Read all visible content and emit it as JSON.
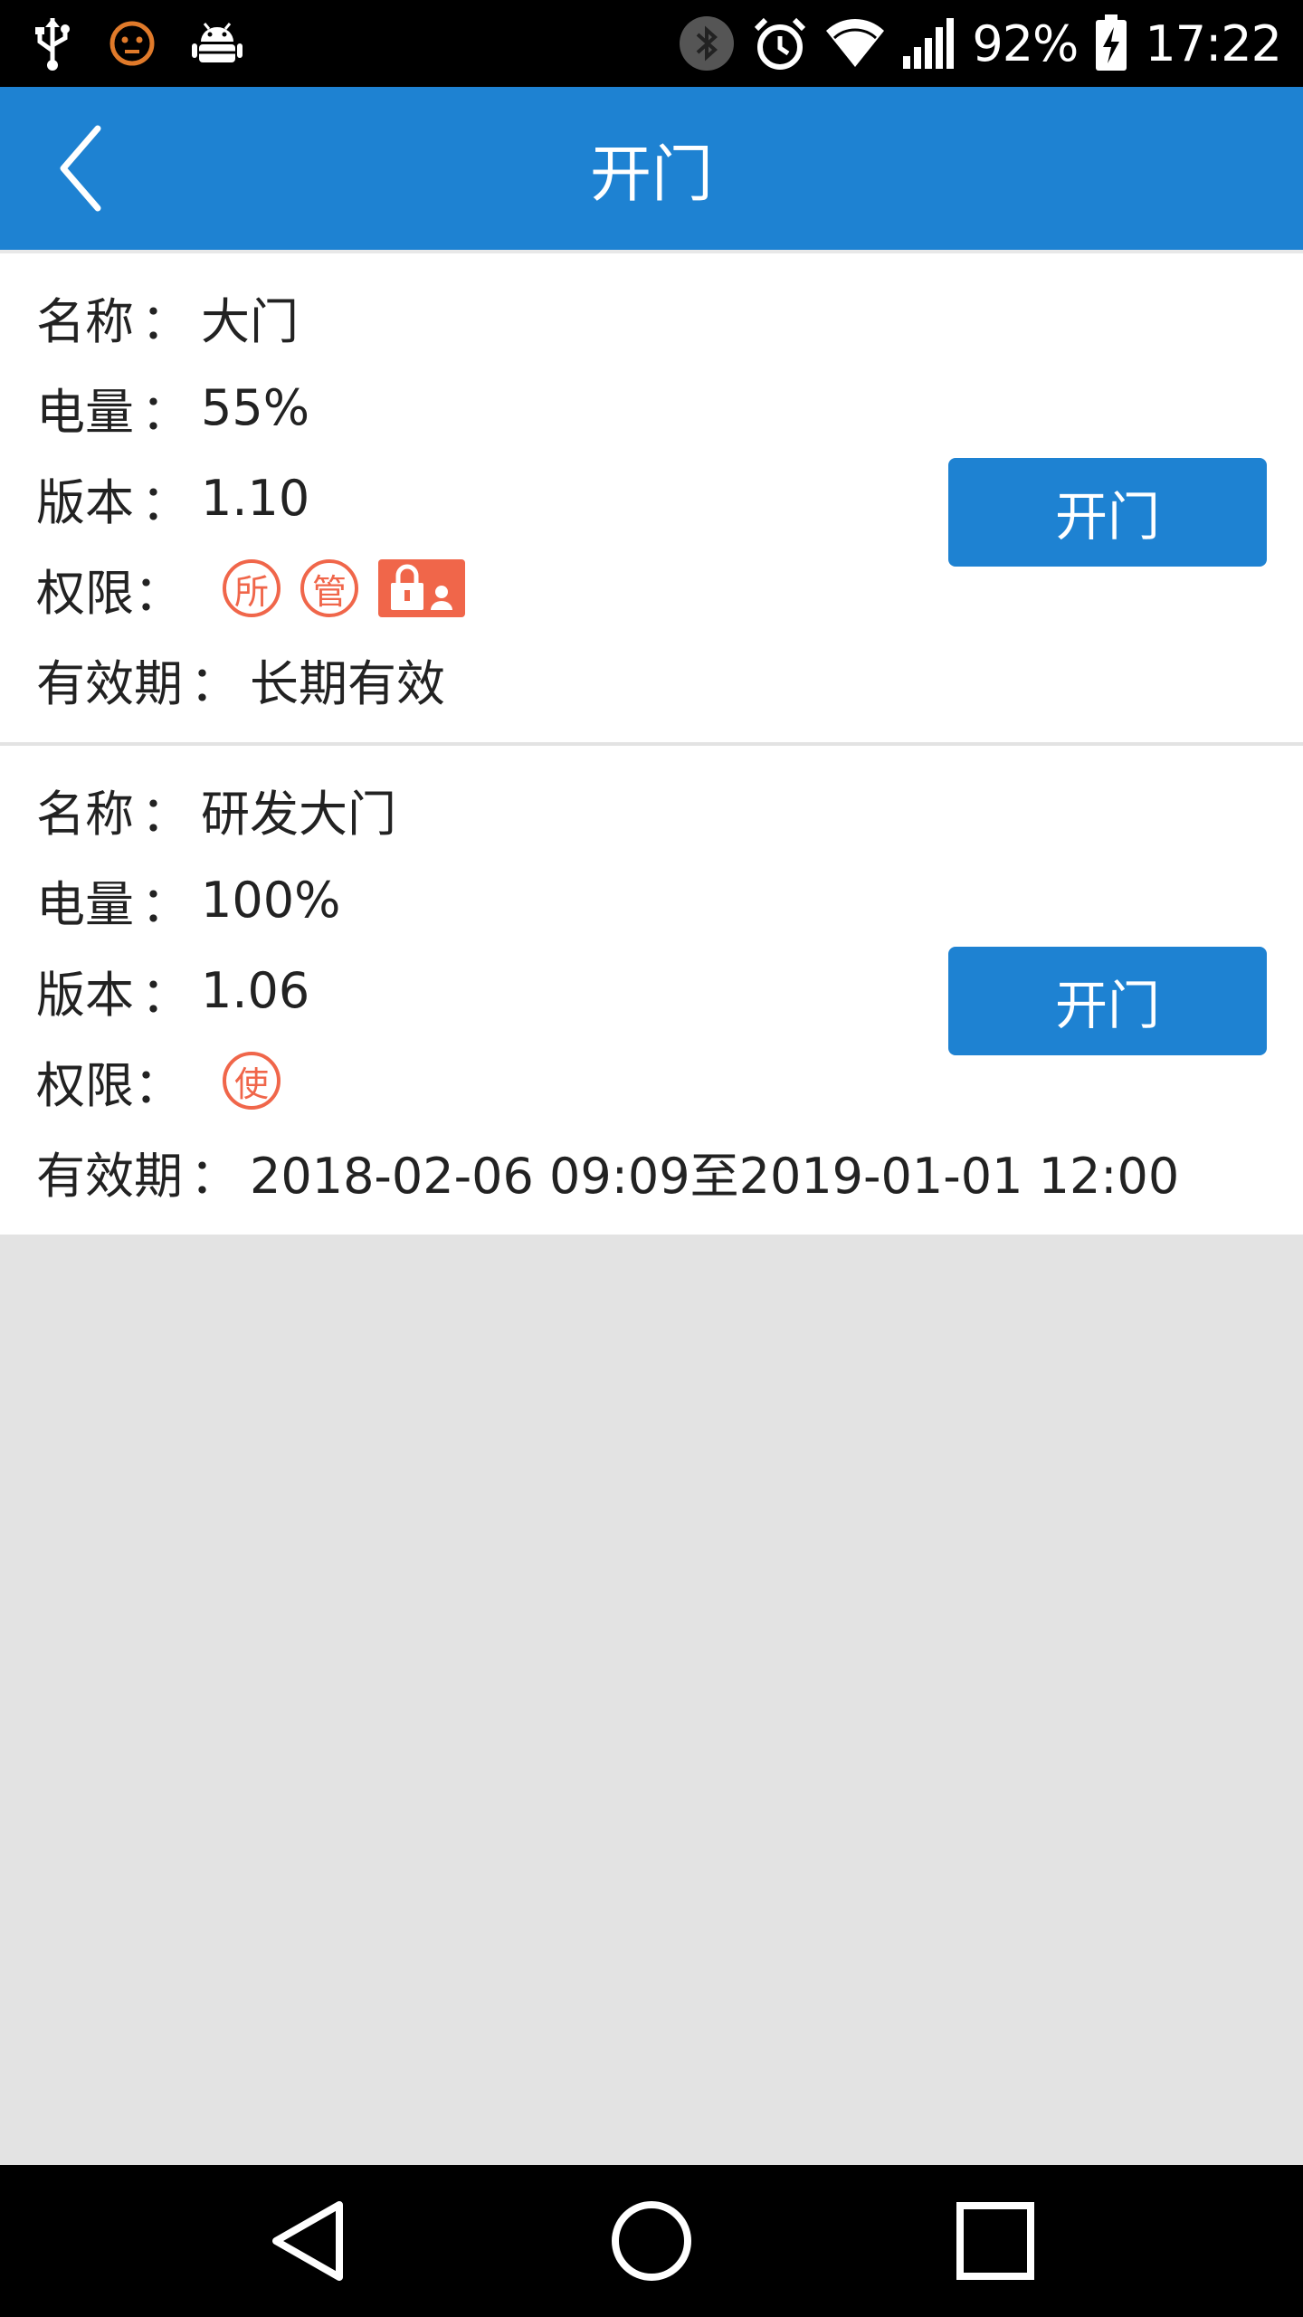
{
  "status_bar": {
    "left_icons": [
      "usb-icon",
      "face-icon",
      "android-icon"
    ],
    "right_icons": [
      "bluetooth-icon",
      "alarm-icon",
      "wifi-icon",
      "signal-icon",
      "battery-charging-icon"
    ],
    "battery": "92%",
    "time": "17:22"
  },
  "app_bar": {
    "title": "开门",
    "back_icon": "chevron-left-icon"
  },
  "devices": [
    {
      "name_label": "名称",
      "name": "大门",
      "battery_label": "电量",
      "battery": "55%",
      "version_label": "版本",
      "version": "1.10",
      "permission_label": "权限：",
      "permissions": [
        "所",
        "管"
      ],
      "permission_lock_icon": "lock-user-icon",
      "validity_label": "有效期",
      "validity": "长期有效",
      "open_button": "开门"
    },
    {
      "name_label": "名称",
      "name": "研发大门",
      "battery_label": "电量",
      "battery": "100%",
      "version_label": "版本",
      "version": "1.06",
      "permission_label": "权限：",
      "permissions": [
        "使"
      ],
      "validity_label": "有效期",
      "validity": "2018-02-06 09:09至2019-01-01 12:00",
      "open_button": "开门"
    }
  ],
  "nav_bar": {
    "icons": [
      "back-triangle-icon",
      "home-circle-icon",
      "recents-square-icon"
    ]
  },
  "colors": {
    "primary": "#1e82d2",
    "permission_accent": "#f0664a",
    "background": "#e3e3e3"
  },
  "separator": "："
}
